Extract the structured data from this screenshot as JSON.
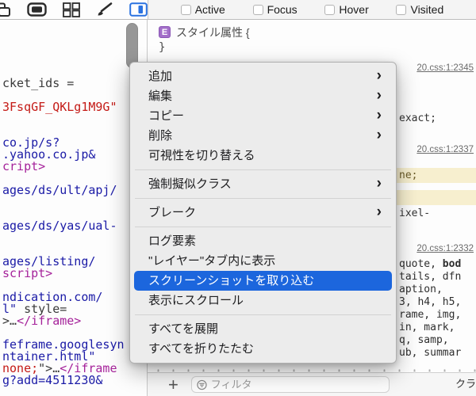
{
  "toolbar": {
    "icons": [
      "device-orientation-icon",
      "display-icon",
      "grid-layout-icon",
      "paintbrush-icon",
      "sidebar-toggle-icon"
    ],
    "checkboxes": [
      {
        "label": "Active",
        "checked": false
      },
      {
        "label": "Focus",
        "checked": false
      },
      {
        "label": "Hover",
        "checked": false
      },
      {
        "label": "Visited",
        "checked": false
      }
    ]
  },
  "code_panel": {
    "lines": [
      [
        {
          "t": "cket_ids =",
          "c": "d"
        }
      ],
      [],
      [
        {
          "t": "3FsqGF_QKLg1M9G\"",
          "c": "r"
        }
      ],
      [],
      [],
      [
        {
          "t": "co.jp/s?",
          "c": "b"
        }
      ],
      [
        {
          "t": ".yahoo.co.jp&",
          "c": "b"
        }
      ],
      [
        {
          "t": "cript>",
          "c": "p"
        }
      ],
      [],
      [
        {
          "t": "ages/ds/ult/apj/",
          "c": "b"
        }
      ],
      [],
      [],
      [
        {
          "t": "ages/ds/yas/ual-",
          "c": "b"
        }
      ],
      [],
      [],
      [
        {
          "t": "ages/listing/",
          "c": "b"
        }
      ],
      [
        {
          "t": "script>",
          "c": "p"
        }
      ],
      [],
      [
        {
          "t": "ndication.com/",
          "c": "b"
        }
      ],
      [
        {
          "t": "l\" ",
          "c": "b"
        },
        {
          "t": "style=",
          "c": "d"
        }
      ],
      [
        {
          "t": ">…",
          "c": "d"
        },
        {
          "t": "</iframe>",
          "c": "p"
        }
      ],
      [],
      [
        {
          "t": "feframe.googlesyn",
          "c": "b"
        }
      ],
      [
        {
          "t": "ntainer.html\"",
          "c": "b"
        }
      ],
      [
        {
          "t": "none;",
          "c": "r"
        },
        {
          "t": "\">…",
          "c": "d"
        },
        {
          "t": "</iframe",
          "c": "p"
        }
      ],
      [
        {
          "t": "g?add=4511230&",
          "c": "b"
        }
      ]
    ]
  },
  "styles_panel": {
    "rule_title_badge": "E",
    "rule_title": "スタイル属性 {",
    "rule_close": "}",
    "source_links": [
      "20.css:1:2345",
      "20.css:1:2337",
      "20.css:1:2332"
    ],
    "fragments": {
      "exact": "exact;",
      "ne": "ne;",
      "ixel": "ixel-"
    },
    "selector_lines": [
      [
        {
          "t": "quote, "
        },
        {
          "t": "bod",
          "b": true
        }
      ],
      [
        {
          "t": "tails, dfn"
        }
      ],
      [
        {
          "t": "aption,"
        }
      ],
      [
        {
          "t": "3, h4, h5,"
        }
      ],
      [
        {
          "t": "rame, img,"
        }
      ],
      [
        {
          "t": "in, mark,"
        }
      ],
      [
        {
          "t": "q, samp,"
        }
      ],
      [
        {
          "t": "ub, summar"
        }
      ]
    ],
    "bottom_bar": {
      "add_label": "+",
      "filter_placeholder": "フィルタ",
      "classes_label": "クラ"
    }
  },
  "context_menu": {
    "highlight_color": "#1c66dd",
    "items": [
      {
        "label": "追加",
        "submenu": true
      },
      {
        "label": "編集",
        "submenu": true
      },
      {
        "label": "コピー",
        "submenu": true
      },
      {
        "label": "削除",
        "submenu": true
      },
      {
        "label": "可視性を切り替える"
      },
      {
        "separator": true
      },
      {
        "label": "強制擬似クラス",
        "submenu": true
      },
      {
        "separator": true
      },
      {
        "label": "ブレーク",
        "submenu": true
      },
      {
        "separator": true
      },
      {
        "label": "ログ要素"
      },
      {
        "label": "\"レイヤー\"タブ内に表示"
      },
      {
        "label": "スクリーンショットを取り込む",
        "highlighted": true
      },
      {
        "label": "表示にスクロール"
      },
      {
        "separator": true
      },
      {
        "label": "すべてを展開"
      },
      {
        "label": "すべてを折りたたむ"
      }
    ]
  }
}
